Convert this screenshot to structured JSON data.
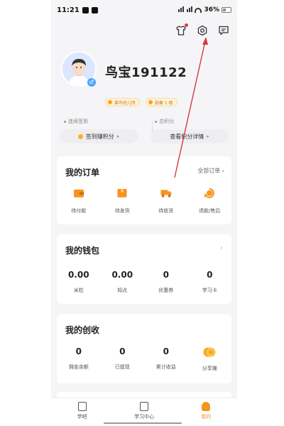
{
  "status_bar": {
    "time": "11:21",
    "battery": "36%"
  },
  "profile": {
    "username": "鸟宝191122",
    "gender_symbol": "♂",
    "badges": [
      "菜鸟托儿所",
      "勋章 1 枚"
    ]
  },
  "points": {
    "left_title": "连续签到",
    "left_button": "签到赚积分",
    "right_title": "总积分",
    "right_button": "查看积分详情"
  },
  "orders": {
    "title": "我的订单",
    "link": "全部订单",
    "items": [
      {
        "label": "待付款",
        "icon": "wallet-icon"
      },
      {
        "label": "待发货",
        "icon": "box-icon"
      },
      {
        "label": "待收货",
        "icon": "truck-icon"
      },
      {
        "label": "退款/售后",
        "icon": "refund-icon"
      }
    ]
  },
  "wallet": {
    "title": "我的钱包",
    "items": [
      {
        "value": "0.00",
        "label": "米粒"
      },
      {
        "value": "0.00",
        "label": "知点"
      },
      {
        "value": "0",
        "label": "优惠券"
      },
      {
        "value": "0",
        "label": "学习卡"
      }
    ]
  },
  "income": {
    "title": "我的创收",
    "items": [
      {
        "value": "0",
        "label": "佣金余额"
      },
      {
        "value": "0",
        "label": "已提现"
      },
      {
        "value": "0",
        "label": "累计收益"
      },
      {
        "value": "",
        "label": "分享赚",
        "icon": "coins-icon"
      }
    ]
  },
  "nav": {
    "items": [
      {
        "label": "学吧",
        "icon": "study-icon",
        "active": false
      },
      {
        "label": "学习中心",
        "icon": "book-icon",
        "active": false
      },
      {
        "label": "我的",
        "icon": "profile-icon",
        "active": true
      }
    ]
  },
  "colors": {
    "accent": "#f7931e",
    "annotation": "#d23b3b"
  }
}
